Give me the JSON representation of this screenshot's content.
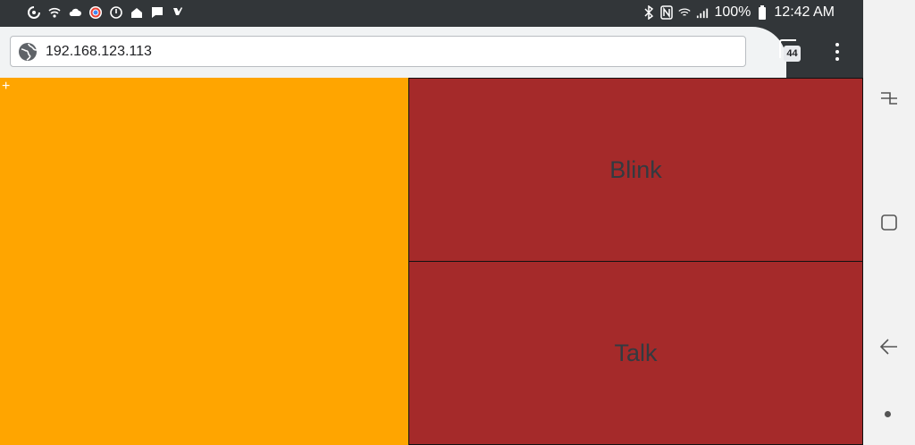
{
  "status_bar": {
    "battery_percent": "100%",
    "time": "12:42 AM",
    "left_icons": [
      "sync-icon",
      "wifi-call-icon",
      "cloud-icon",
      "chrome-icon",
      "power-icon",
      "home-icon",
      "message-icon",
      "checklist-icon"
    ],
    "right_icons": [
      "bluetooth-icon",
      "nfc-icon",
      "wifi-icon",
      "signal-icon",
      "battery-icon"
    ]
  },
  "browser": {
    "url": "192.168.123.113",
    "tab_count": "44"
  },
  "page": {
    "left_panel_marker": "+",
    "tiles": [
      {
        "label": "Blink",
        "color": "#a52a2a"
      },
      {
        "label": "Talk",
        "color": "#a52a2a"
      }
    ],
    "left_panel_color": "#ffa500"
  },
  "navigation": {
    "buttons": [
      "recent-apps-icon",
      "home-icon",
      "back-icon"
    ]
  }
}
